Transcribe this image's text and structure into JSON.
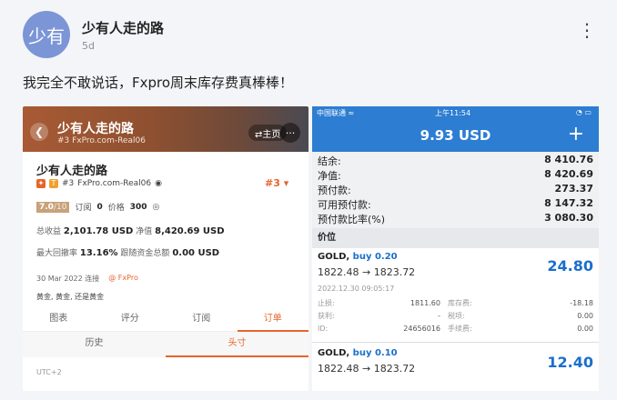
{
  "post": {
    "avatar_text": "少有",
    "author": "少有人走的路",
    "time": "5d",
    "more": "⋮",
    "text": "我完全不敢说话，Fxpro周末库存费真棒棒！"
  },
  "left_panel": {
    "header_title": "少有人走的路",
    "header_sub": "#3 FxPro.com-Real06",
    "home_label": "⇄主页",
    "more_label": "···",
    "name": "少有人走的路",
    "rank_line": "#3",
    "account": "FxPro.com-Real06",
    "rank_badge": "#3 ▾",
    "score": "7.0",
    "score_suffix": "/10",
    "orders_label": "订阅",
    "orders_value": "0",
    "price_label": "价格",
    "price_value": "300",
    "profit_label": "总收益",
    "profit_value": "2,101.78 USD",
    "equity_label": "净值",
    "equity_value": "8,420.69 USD",
    "drawdown_label": "最大回撤率",
    "drawdown_value": "13.16%",
    "follow_label": "跟随资金总额",
    "follow_value": "0.00 USD",
    "date_text": "30 Mar 2022 连接",
    "broker": "@ FxPro",
    "tags": "黄金, 黄金, 还是黄金",
    "tabs": [
      "图表",
      "评分",
      "订阅",
      "订单"
    ],
    "subtabs": [
      "历史",
      "头寸"
    ],
    "utc": "UTC+2"
  },
  "right_panel": {
    "carrier": "中国联通 ≈",
    "clock": "上午11:54",
    "battery": "◔ ▭",
    "title": "9.93 USD",
    "plus": "+",
    "summary": [
      {
        "label": "结余:",
        "value": "8 410.76"
      },
      {
        "label": "净值:",
        "value": "8 420.69"
      },
      {
        "label": "预付款:",
        "value": "273.37"
      },
      {
        "label": "可用预付款:",
        "value": "8 147.32"
      },
      {
        "label": "预付款比率(%)",
        "value": "3 080.30"
      }
    ],
    "section": "价位",
    "positions": [
      {
        "symbol": "GOLD,",
        "side": "buy 0.20",
        "prices": "1822.48 → 1823.72",
        "profit": "24.80",
        "date": "2022.12.30 09:05:17",
        "details": [
          {
            "k1": "止损:",
            "v1": "1811.60",
            "k2": "库存费:",
            "v2": "-18.18"
          },
          {
            "k1": "获利:",
            "v1": "-",
            "k2": "税项:",
            "v2": "0.00"
          },
          {
            "k1": "ID:",
            "v1": "24656016",
            "k2": "手续费:",
            "v2": "0.00"
          }
        ]
      },
      {
        "symbol": "GOLD,",
        "side": "buy 0.10",
        "prices": "1822.48 → 1823.72",
        "profit": "12.40"
      }
    ]
  }
}
